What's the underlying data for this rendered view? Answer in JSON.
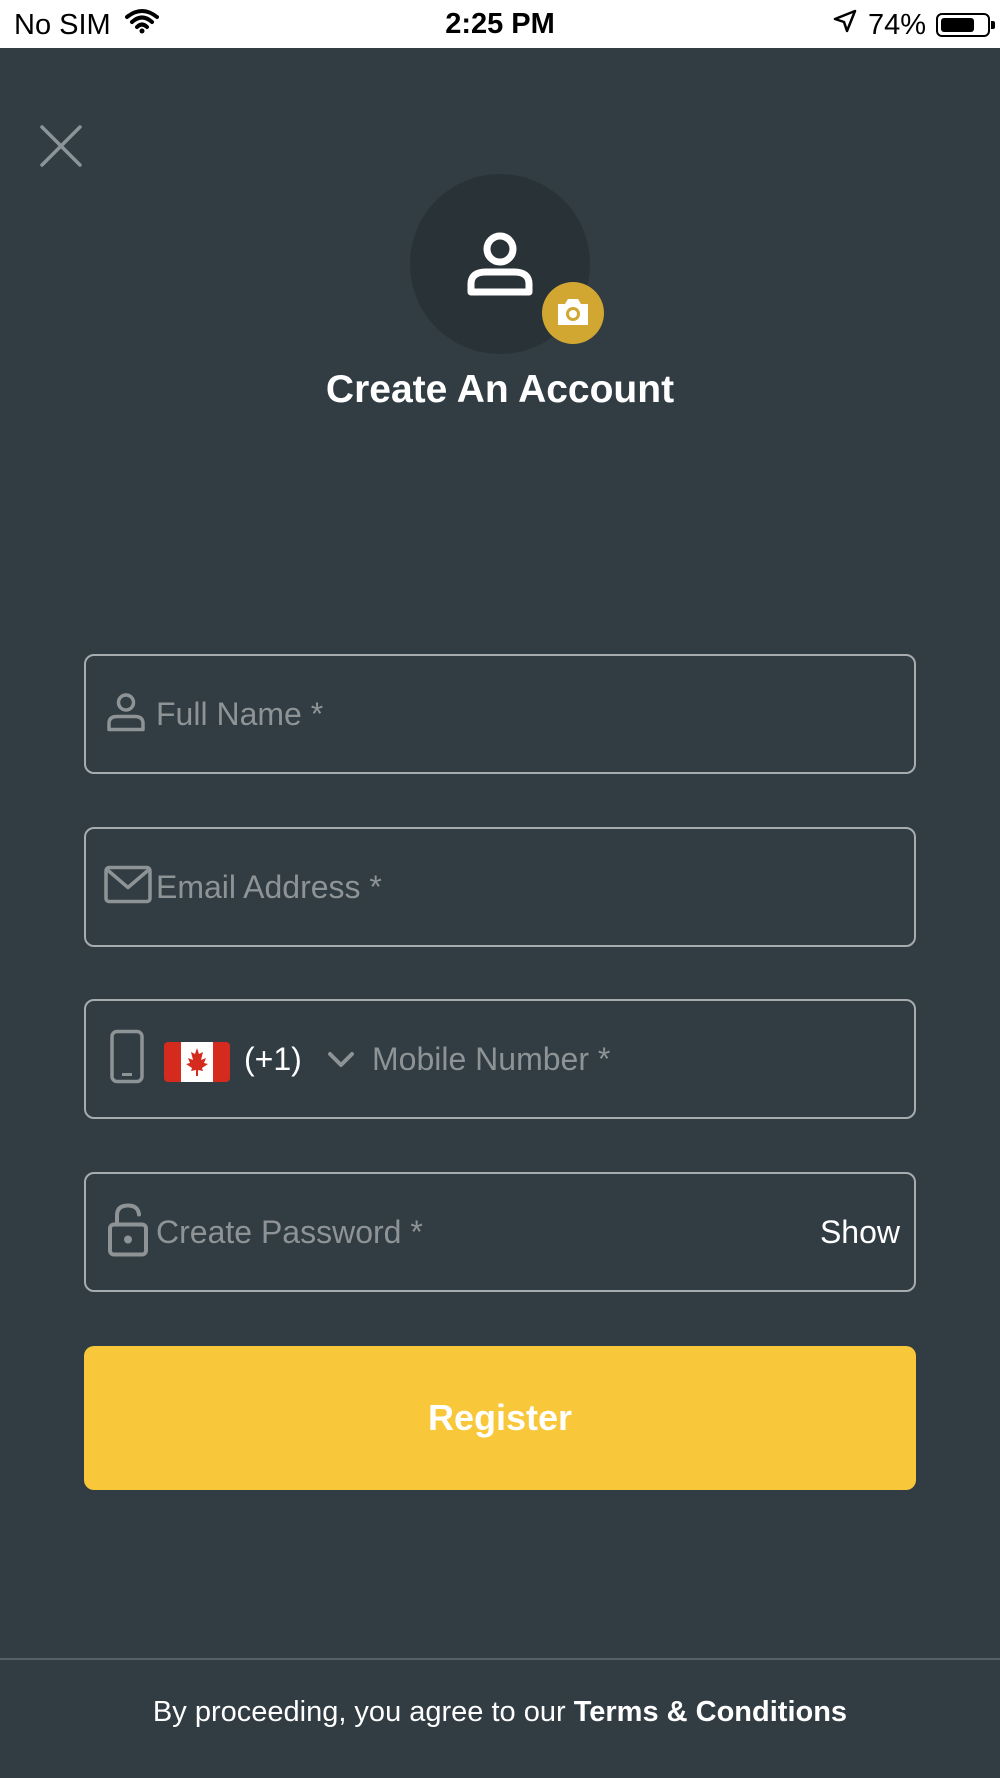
{
  "status_bar": {
    "carrier": "No SIM",
    "time": "2:25 PM",
    "battery_percent": "74%",
    "battery_level": 0.74
  },
  "header": {
    "close_icon": "close-icon",
    "title": "Create An Account"
  },
  "avatar": {
    "icon": "person-icon",
    "badge_icon": "camera-icon",
    "badge_color": "#d2a731"
  },
  "form": {
    "full_name": {
      "placeholder": "Full Name *",
      "value": "",
      "icon": "person-outline-icon"
    },
    "email": {
      "placeholder": "Email Address *",
      "value": "",
      "icon": "mail-icon"
    },
    "mobile": {
      "placeholder": "Mobile Number *",
      "value": "",
      "icon": "phone-icon",
      "country_flag": "canada-flag-icon",
      "dial_code": "(+1)"
    },
    "password": {
      "placeholder": "Create Password *",
      "value": "",
      "icon": "lock-icon",
      "toggle_label": "Show"
    },
    "register_label": "Register"
  },
  "footer": {
    "text": "By proceeding, you agree to our ",
    "link_label": "Terms & Conditions"
  },
  "colors": {
    "background": "#313c43",
    "accent": "#f9c73a",
    "field_border": "#a7acaf"
  }
}
